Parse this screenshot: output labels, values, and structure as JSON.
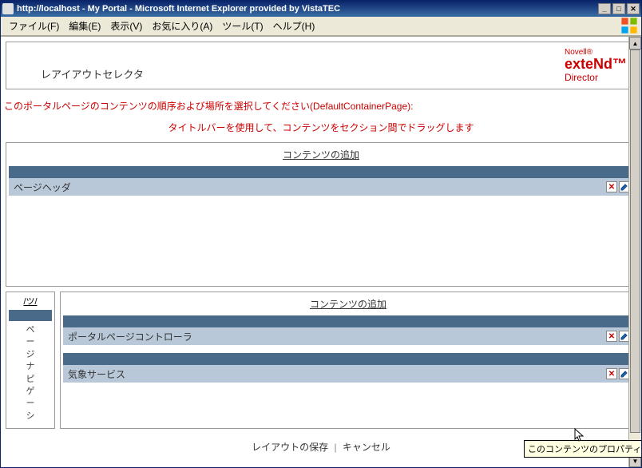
{
  "window": {
    "title": "http://localhost - My Portal - Microsoft Internet Explorer provided by VistaTEC"
  },
  "menu": {
    "file": "ファイル(F)",
    "edit": "編集(E)",
    "view": "表示(V)",
    "favorites": "お気に入り(A)",
    "tools": "ツール(T)",
    "help": "ヘルプ(H)"
  },
  "brand": {
    "line1": "Novell®",
    "line2": "exteNd™",
    "line3": "Director"
  },
  "header": {
    "selector_title": "レアイアウトセレクタ"
  },
  "messages": {
    "instruction": "このポータルページのコンテンツの順序および場所を選択してください(DefaultContainerPage):",
    "drag_hint": "タイトルバーを使用して、コンテンツをセクション間でドラッグします",
    "add_content": "コンテンツの追加",
    "add_content_short": "/ツ/"
  },
  "top_section": {
    "items": [
      {
        "label": "ページヘッダ"
      }
    ]
  },
  "sidebar": {
    "label_chars": [
      "ペ",
      "ー",
      "ジ",
      "ナ",
      "ピ",
      "ゲ",
      "ー",
      "シ"
    ]
  },
  "main_section": {
    "items": [
      {
        "label": "ポータルページコントローラ"
      },
      {
        "label": "気象サービス"
      }
    ]
  },
  "tooltip": {
    "text": "このコンテンツのプロパティを変更します。"
  },
  "footer": {
    "save": "レイアウトの保存",
    "cancel": "キャンセル"
  },
  "icons": {
    "delete_glyph": "✕",
    "min_glyph": "_",
    "max_glyph": "□",
    "close_glyph": "✕",
    "up_glyph": "▲",
    "down_glyph": "▼"
  }
}
